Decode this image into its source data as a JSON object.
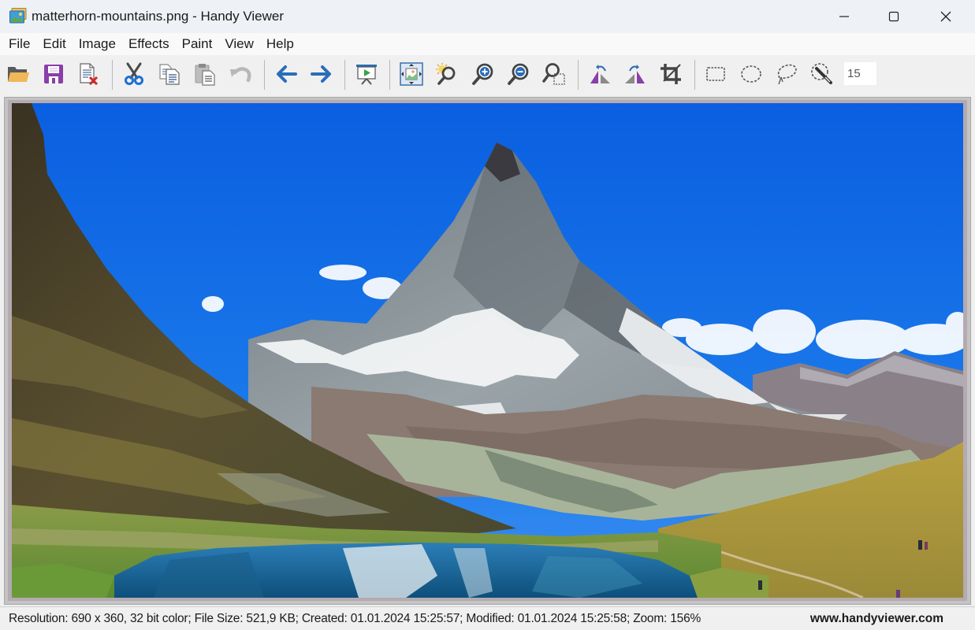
{
  "window": {
    "title": "matterhorn-mountains.png - Handy Viewer",
    "app_icon": "image-viewer-icon",
    "controls": {
      "minimize": "minimize-icon",
      "maximize": "maximize-icon",
      "close": "close-icon"
    }
  },
  "menubar": {
    "items": [
      {
        "label": "File"
      },
      {
        "label": "Edit"
      },
      {
        "label": "Image"
      },
      {
        "label": "Effects"
      },
      {
        "label": "Paint"
      },
      {
        "label": "View"
      },
      {
        "label": "Help"
      }
    ]
  },
  "toolbar": {
    "buttons": [
      {
        "name": "open",
        "icon": "folder-open-icon"
      },
      {
        "name": "save",
        "icon": "floppy-disk-icon"
      },
      {
        "name": "close-file",
        "icon": "document-delete-icon"
      },
      {
        "name": "cut",
        "icon": "scissors-icon"
      },
      {
        "name": "copy",
        "icon": "copy-icon"
      },
      {
        "name": "paste",
        "icon": "paste-icon"
      },
      {
        "name": "undo",
        "icon": "undo-icon"
      },
      {
        "name": "previous",
        "icon": "arrow-left-icon"
      },
      {
        "name": "next",
        "icon": "arrow-right-icon"
      },
      {
        "name": "slideshow",
        "icon": "slideshow-icon"
      },
      {
        "name": "fit-to-window",
        "icon": "fit-to-window-icon"
      },
      {
        "name": "auto-zoom",
        "icon": "zoom-auto-icon"
      },
      {
        "name": "zoom-in",
        "icon": "zoom-in-icon"
      },
      {
        "name": "zoom-out",
        "icon": "zoom-out-icon"
      },
      {
        "name": "zoom-selection",
        "icon": "zoom-selection-icon"
      },
      {
        "name": "flip-horizontal",
        "icon": "flip-horizontal-icon"
      },
      {
        "name": "flip-vertical",
        "icon": "flip-vertical-icon"
      },
      {
        "name": "crop",
        "icon": "crop-icon"
      },
      {
        "name": "rectangle-select",
        "icon": "rectangle-select-icon"
      },
      {
        "name": "ellipse-select",
        "icon": "ellipse-select-icon"
      },
      {
        "name": "lasso-select",
        "icon": "lasso-select-icon"
      },
      {
        "name": "magic-wand",
        "icon": "magic-wand-icon"
      }
    ],
    "tolerance_value": "15"
  },
  "image": {
    "description": "Matterhorn mountain with alpine lake",
    "colors": {
      "sky_top": "#0a5fe0",
      "sky_bottom": "#2a86ee",
      "frame": "#b4aab0"
    }
  },
  "statusbar": {
    "info": "Resolution: 690 x 360, 32 bit color; File Size: 521,9 KB; Created: 01.01.2024 15:25:57; Modified: 01.01.2024 15:25:58; Zoom: 156%",
    "website": "www.handyviewer.com"
  }
}
